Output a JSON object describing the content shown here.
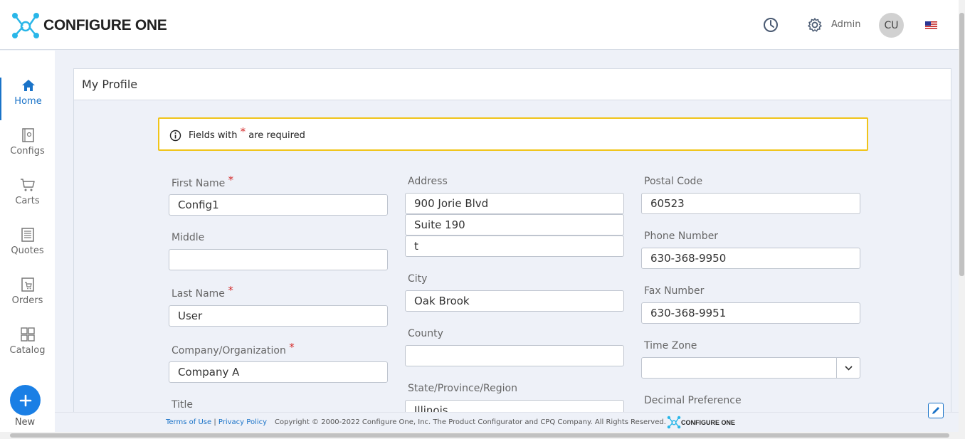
{
  "header": {
    "brand": "CONFIGURE ONE",
    "admin_label": "Admin",
    "avatar_initials": "CU"
  },
  "sidebar": {
    "items": [
      {
        "label": "Home",
        "icon": "home-icon"
      },
      {
        "label": "Configs",
        "icon": "configs-icon"
      },
      {
        "label": "Carts",
        "icon": "cart-icon"
      },
      {
        "label": "Quotes",
        "icon": "quotes-icon"
      },
      {
        "label": "Orders",
        "icon": "orders-icon"
      },
      {
        "label": "Catalog",
        "icon": "catalog-icon"
      }
    ],
    "new_label": "New"
  },
  "page": {
    "title": "My Profile",
    "notice_before": "Fields with",
    "notice_star": "*",
    "notice_after": "are required"
  },
  "form": {
    "first_name": {
      "label": "First Name",
      "value": "Config1"
    },
    "middle": {
      "label": "Middle",
      "value": ""
    },
    "last_name": {
      "label": "Last Name",
      "value": "User"
    },
    "company": {
      "label": "Company/Organization",
      "value": "Company A"
    },
    "title": {
      "label": "Title"
    },
    "address": {
      "label": "Address",
      "line1": "900 Jorie Blvd",
      "line2": "Suite 190",
      "line3": "t"
    },
    "city": {
      "label": "City",
      "value": "Oak Brook"
    },
    "county": {
      "label": "County",
      "value": ""
    },
    "state": {
      "label": "State/Province/Region",
      "value": "Illinois"
    },
    "postal_code": {
      "label": "Postal Code",
      "value": "60523"
    },
    "phone": {
      "label": "Phone Number",
      "value": "630-368-9950"
    },
    "fax": {
      "label": "Fax Number",
      "value": "630-368-9951"
    },
    "time_zone": {
      "label": "Time Zone",
      "value": ""
    },
    "decimal_pref": {
      "label": "Decimal Preference"
    },
    "required_star": "*"
  },
  "footer": {
    "terms": "Terms of Use",
    "separator": "|",
    "privacy": "Privacy Policy",
    "copyright": "Copyright © 2000-2022 Configure One, Inc. The Product Configurator and CPQ Company. All Rights Reserved.",
    "brand": "CONFIGURE ONE"
  },
  "colors": {
    "accent": "#1a73c8",
    "notice_border": "#f0c419",
    "required": "#d42a2a",
    "logo": "#29b6e8"
  }
}
